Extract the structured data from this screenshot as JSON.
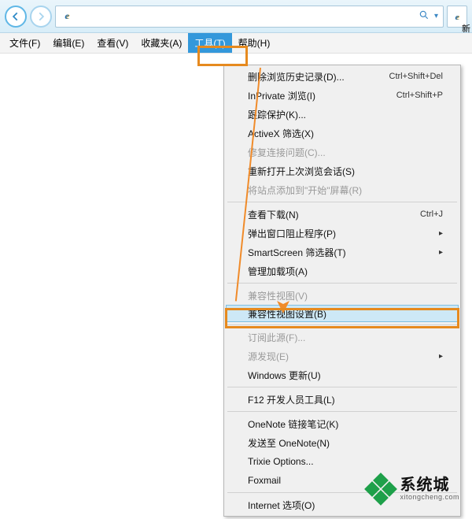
{
  "tab_label": "新",
  "menubar": {
    "file": "文件(F)",
    "edit": "编辑(E)",
    "view": "查看(V)",
    "favorites": "收藏夹(A)",
    "tools": "工具(T)",
    "help": "帮助(H)"
  },
  "dropdown": {
    "delete_history": "删除浏览历史记录(D)...",
    "delete_history_sc": "Ctrl+Shift+Del",
    "inprivate": "InPrivate 浏览(I)",
    "inprivate_sc": "Ctrl+Shift+P",
    "tracking": "跟踪保护(K)...",
    "activex": "ActiveX 筛选(X)",
    "fix_conn": "修复连接问题(C)...",
    "reopen": "重新打开上次浏览会话(S)",
    "add_start": "将站点添加到\"开始\"屏幕(R)",
    "downloads": "查看下载(N)",
    "downloads_sc": "Ctrl+J",
    "popup": "弹出窗口阻止程序(P)",
    "sc_filter": "SmartScreen 筛选器(T)",
    "manage_addons": "管理加载项(A)",
    "compat_view": "兼容性视图(V)",
    "compat_settings": "兼容性视图设置(B)",
    "feed_sub": "订阅此源(F)...",
    "feed_find": "源发现(E)",
    "win_update": "Windows 更新(U)",
    "f12": "F12 开发人员工具(L)",
    "onenote_link": "OneNote 链接笔记(K)",
    "onenote_send": "发送至 OneNote(N)",
    "trixie": "Trixie Options...",
    "foxmail": "Foxmail",
    "internet_opts": "Internet 选项(O)",
    "submenu_arrow": "▸"
  },
  "watermark": {
    "cn": "系统城",
    "en": "xitongcheng.com"
  }
}
